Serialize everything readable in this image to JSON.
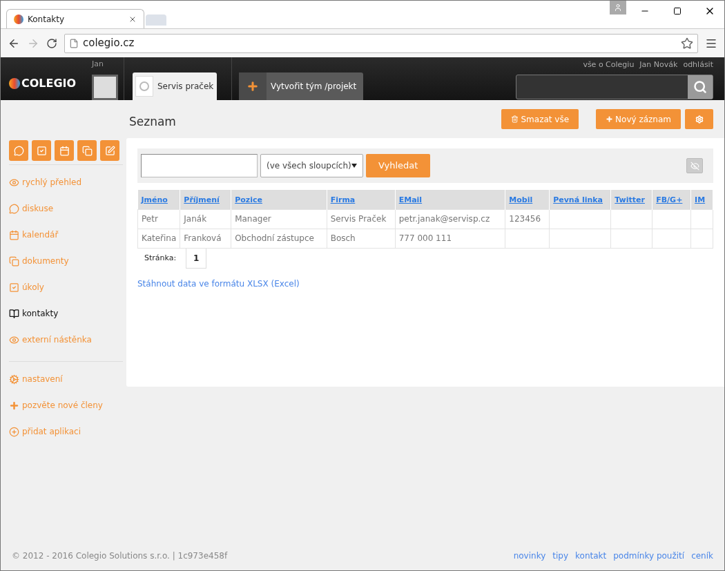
{
  "browser": {
    "tab_title": "Kontakty",
    "url": "colegio.cz"
  },
  "header": {
    "logo": "COLEGIO",
    "user_name": "Jan",
    "project_tab": "Servis praček",
    "create_button": "Vytvořit tým /projekt",
    "links": [
      "vše o Colegiu",
      "Jan Novák",
      "odhlásit"
    ]
  },
  "toolbar_icons": [
    {
      "kind": "chat"
    },
    {
      "kind": "check"
    },
    {
      "kind": "calendar"
    },
    {
      "kind": "copy"
    },
    {
      "kind": "edit"
    }
  ],
  "sidebar": {
    "items": [
      {
        "kind": "eye",
        "label": "rychlý přehled",
        "selected": false
      },
      {
        "kind": "chat",
        "label": "diskuse",
        "selected": false
      },
      {
        "kind": "calendar",
        "label": "kalendář",
        "selected": false
      },
      {
        "kind": "copy",
        "label": "dokumenty",
        "selected": false
      },
      {
        "kind": "check",
        "label": "úkoly",
        "selected": false
      },
      {
        "kind": "book",
        "label": "kontakty",
        "selected": true
      },
      {
        "kind": "eye",
        "label": "externí nástěnka",
        "selected": false
      }
    ],
    "extra_items": [
      {
        "kind": "gears",
        "label": "nastavení"
      },
      {
        "kind": "plus",
        "label": "pozvěte nové členy"
      },
      {
        "kind": "plus-circle",
        "label": "přidat aplikaci"
      }
    ]
  },
  "page": {
    "title": "Seznam",
    "delete_button": "Smazat vše",
    "new_button": "Nový záznam"
  },
  "search": {
    "scope": "(ve všech sloupcích)",
    "button": "Vyhledat"
  },
  "table": {
    "columns": [
      "Jméno",
      "Příjmení",
      "Pozice",
      "Firma",
      "EMail",
      "Mobil",
      "Pevná linka",
      "Twitter",
      "FB/G+",
      "IM"
    ],
    "rows": [
      [
        "Petr",
        "Janák",
        "Manager",
        "Servis Praček",
        "petr.janak@servisp.cz",
        "123456",
        "",
        "",
        "",
        ""
      ],
      [
        "Kateřina",
        "Franková",
        "Obchodní zástupce",
        "Bosch",
        "777 000 111",
        "",
        "",
        "",
        "",
        ""
      ]
    ]
  },
  "pagination": {
    "label": "Stránka:",
    "pages": [
      {
        "label": "1",
        "selected": true
      }
    ]
  },
  "download_link": "Stáhnout data ve formátu XLSX (Excel)",
  "footer": {
    "copyright": "© 2012 - 2016 Colegio Solutions s.r.o. | 1c973e458f",
    "links": [
      "novinky",
      "tipy",
      "kontakt",
      "podmínky použití",
      "ceník"
    ]
  }
}
